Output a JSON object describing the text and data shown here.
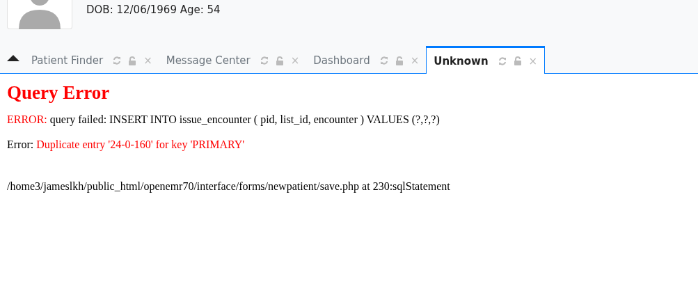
{
  "patient": {
    "dob_age": "DOB: 12/06/1969 Age: 54"
  },
  "tabs": [
    {
      "label": "Patient Finder",
      "close": "×",
      "selected": false
    },
    {
      "label": "Message Center",
      "close": "×",
      "selected": false
    },
    {
      "label": "Dashboard",
      "close": "×",
      "selected": false
    },
    {
      "label": "Unknown",
      "close": "×",
      "selected": true
    }
  ],
  "content": {
    "title": "Query Error",
    "error_line": {
      "label": "ERROR:",
      "text": "query failed: INSERT INTO issue_encounter ( pid, list_id, encounter ) VALUES (?,?,?)"
    },
    "detail_line": {
      "label": "Error:",
      "text": "Duplicate entry '24-0-160' for key 'PRIMARY'"
    },
    "path": "/home3/jameslkh/public_html/openemr70/interface/forms/newpatient/save.php at 230:sqlStatement"
  }
}
